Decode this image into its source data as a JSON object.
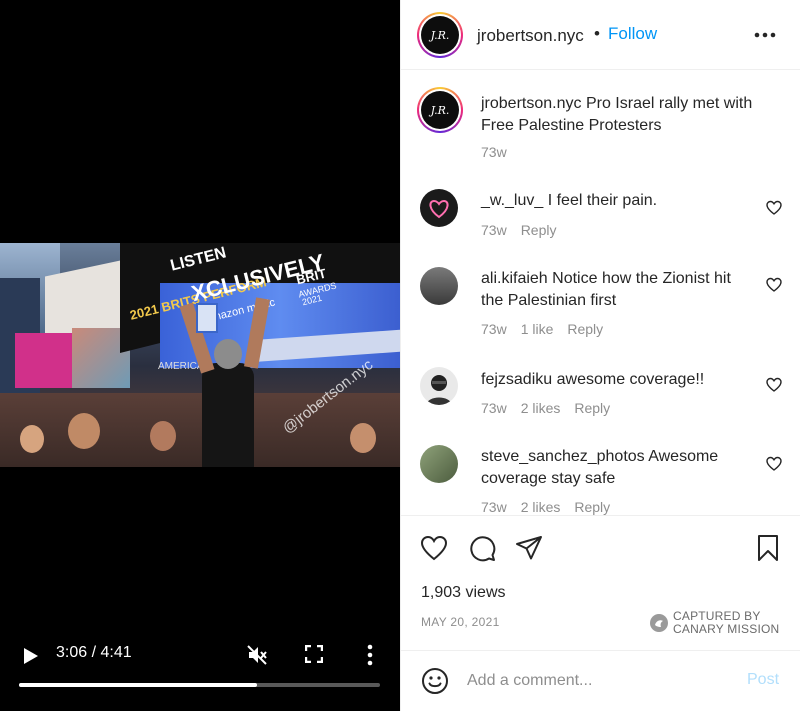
{
  "video": {
    "time": "3:06 / 4:41",
    "progress": 0.66,
    "watermark": "@jrobertson.nyc",
    "billboard_listen": "LISTEN",
    "billboard_exclusively": "XCLUSIVELY",
    "billboard_brit": "BRIT",
    "billboard_awards": "AWARDS",
    "billboard_year": "2021",
    "billboard_amazon": "amazon music",
    "billboard_perform": "2021 BRITS PERFORM",
    "billboard_america": "AMERICA"
  },
  "header": {
    "username": "jrobertson.nyc",
    "dot": "•",
    "follow_label": "Follow",
    "avatar_text": "J.R."
  },
  "caption": {
    "username": "jrobertson.nyc",
    "text": "Pro Israel rally met with Free Palestine Protesters",
    "time": "73w"
  },
  "comments": [
    {
      "username": "_w._luv_",
      "text": "I feel their pain.",
      "time": "73w",
      "likes": "",
      "reply": "Reply"
    },
    {
      "username": "ali.kifaieh",
      "text": "Notice how the Zionist hit the Palestinian first",
      "time": "73w",
      "likes": "1 like",
      "reply": "Reply"
    },
    {
      "username": "fejzsadiku",
      "text": "awesome coverage!!",
      "time": "73w",
      "likes": "2 likes",
      "reply": "Reply"
    },
    {
      "username": "steve_sanchez_photos",
      "text": "Awesome coverage stay safe",
      "time": "73w",
      "likes": "2 likes",
      "reply": "Reply"
    }
  ],
  "actions": {
    "views": "1,903 views",
    "date": "MAY 20, 2021"
  },
  "captured": {
    "line1": "CAPTURED BY",
    "line2": "CANARY MISSION"
  },
  "comment_box": {
    "placeholder": "Add a comment...",
    "post_label": "Post"
  },
  "colors": {
    "link_blue": "#0095f6",
    "post_disabled": "#b2dffc",
    "muted_gray": "#8e8e8e"
  }
}
